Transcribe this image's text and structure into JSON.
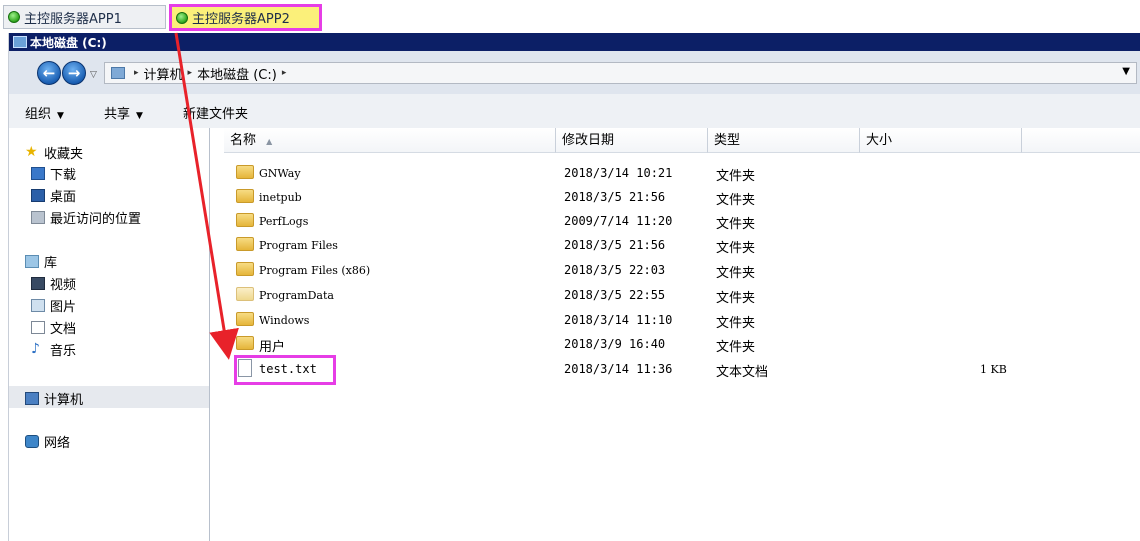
{
  "tabs": [
    {
      "label": "主控服务器APP1",
      "active": false
    },
    {
      "label": "主控服务器APP2",
      "active": true
    }
  ],
  "window_title": "本地磁盘 (C:)",
  "address": {
    "segments": [
      "计算机",
      "本地磁盘 (C:)"
    ]
  },
  "toolbar": {
    "organize": "组织",
    "share": "共享",
    "new_folder": "新建文件夹"
  },
  "nav": {
    "favorites": "收藏夹",
    "downloads": "下载",
    "desktop": "桌面",
    "recent": "最近访问的位置",
    "libraries": "库",
    "videos": "视频",
    "pictures": "图片",
    "documents": "文档",
    "music": "音乐",
    "computer": "计算机",
    "network": "网络"
  },
  "columns": {
    "name": "名称",
    "modified": "修改日期",
    "type": "类型",
    "size": "大小"
  },
  "files": [
    {
      "name": "GNWay",
      "modified": "2018/3/14 10:21",
      "type": "文件夹",
      "size": "",
      "icon": "folder-icon"
    },
    {
      "name": "inetpub",
      "modified": "2018/3/5 21:56",
      "type": "文件夹",
      "size": "",
      "icon": "folder-icon"
    },
    {
      "name": "PerfLogs",
      "modified": "2009/7/14 11:20",
      "type": "文件夹",
      "size": "",
      "icon": "folder-icon"
    },
    {
      "name": "Program Files",
      "modified": "2018/3/5 21:56",
      "type": "文件夹",
      "size": "",
      "icon": "folder-icon"
    },
    {
      "name": "Program Files (x86)",
      "modified": "2018/3/5 22:03",
      "type": "文件夹",
      "size": "",
      "icon": "folder-icon"
    },
    {
      "name": "ProgramData",
      "modified": "2018/3/5 22:55",
      "type": "文件夹",
      "size": "",
      "icon": "folder-icon"
    },
    {
      "name": "Windows",
      "modified": "2018/3/14 11:10",
      "type": "文件夹",
      "size": "",
      "icon": "folder-icon"
    },
    {
      "name": "用户",
      "modified": "2018/3/9 16:40",
      "type": "文件夹",
      "size": "",
      "icon": "folder-icon"
    },
    {
      "name": "test.txt",
      "modified": "2018/3/14 11:36",
      "type": "文本文档",
      "size": "1 KB",
      "icon": "text-file-icon"
    }
  ],
  "colors": {
    "highlight": "#e63de6",
    "arrow": "#e8222a",
    "title_bar": "#0c1f66"
  }
}
